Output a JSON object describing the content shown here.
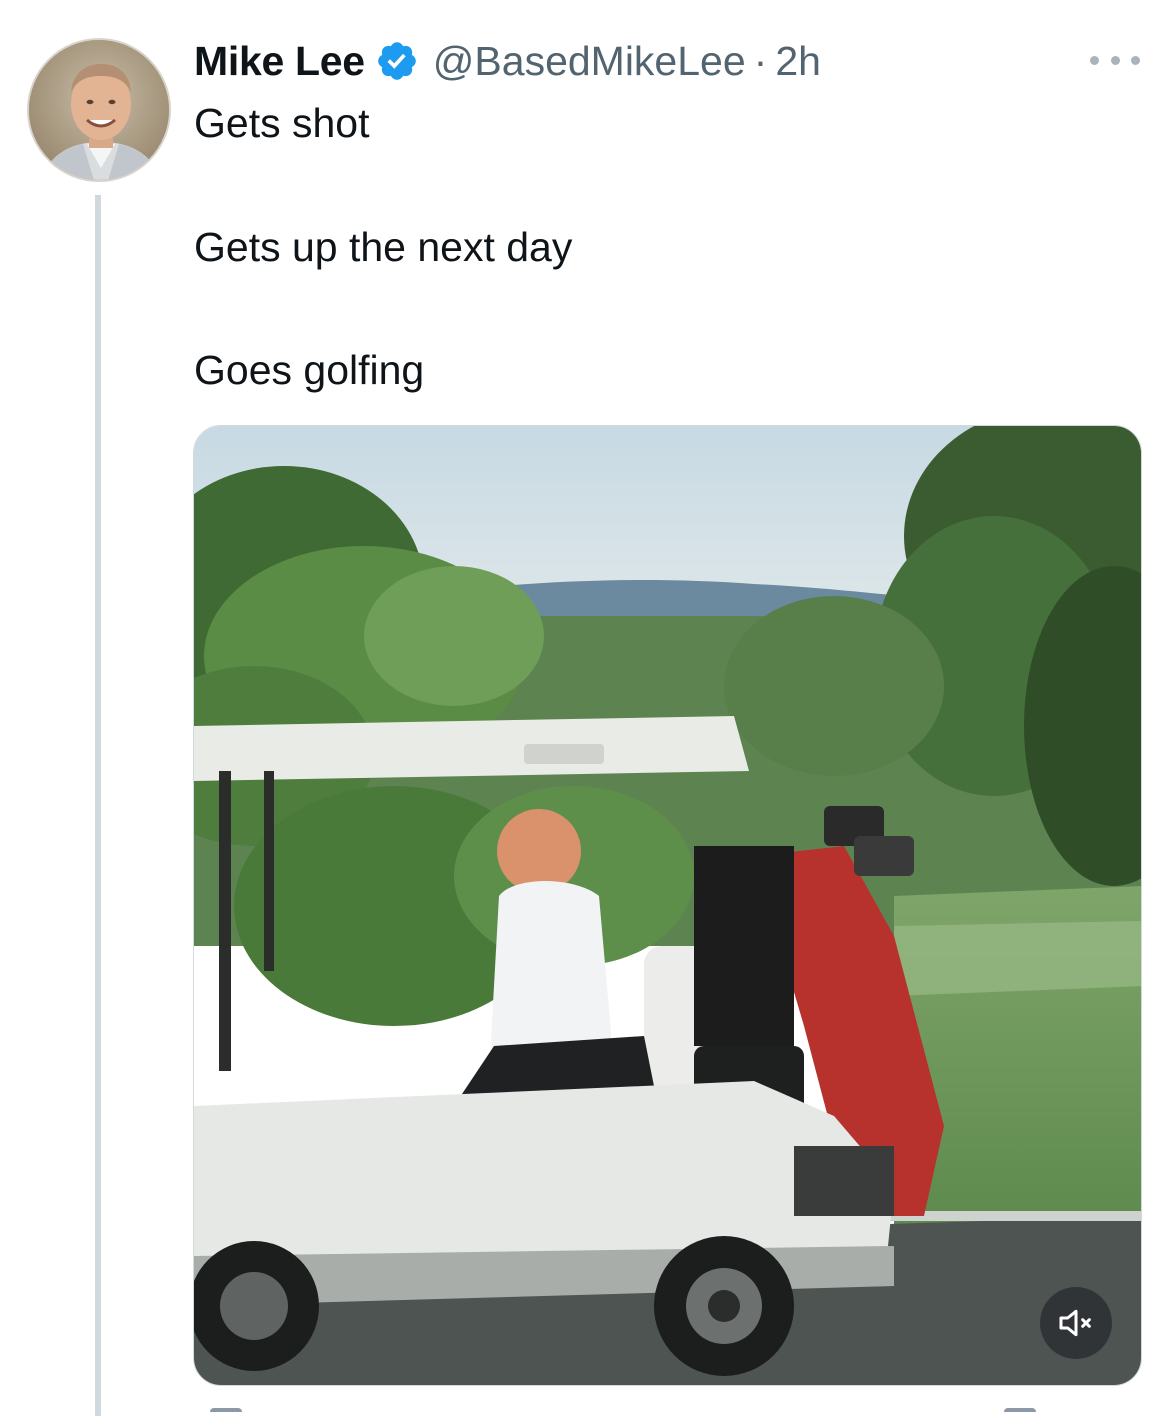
{
  "author": {
    "name": "Mike Lee",
    "handle": "@BasedMikeLee",
    "separator": "·",
    "time": "2h",
    "verified": true,
    "avatar_icon": "profile-photo"
  },
  "tweet": {
    "lines": [
      "Gets shot",
      "Gets up the next day",
      "Goes golfing"
    ]
  },
  "media": {
    "type": "video",
    "scene_icon": "golf-cart-video-frame",
    "mute_icon": "speaker-muted-icon"
  },
  "colors": {
    "text": "#0f1419",
    "secondary": "#536471",
    "verified_blue": "#1d9bf0",
    "thread_line": "#cfd9de"
  }
}
